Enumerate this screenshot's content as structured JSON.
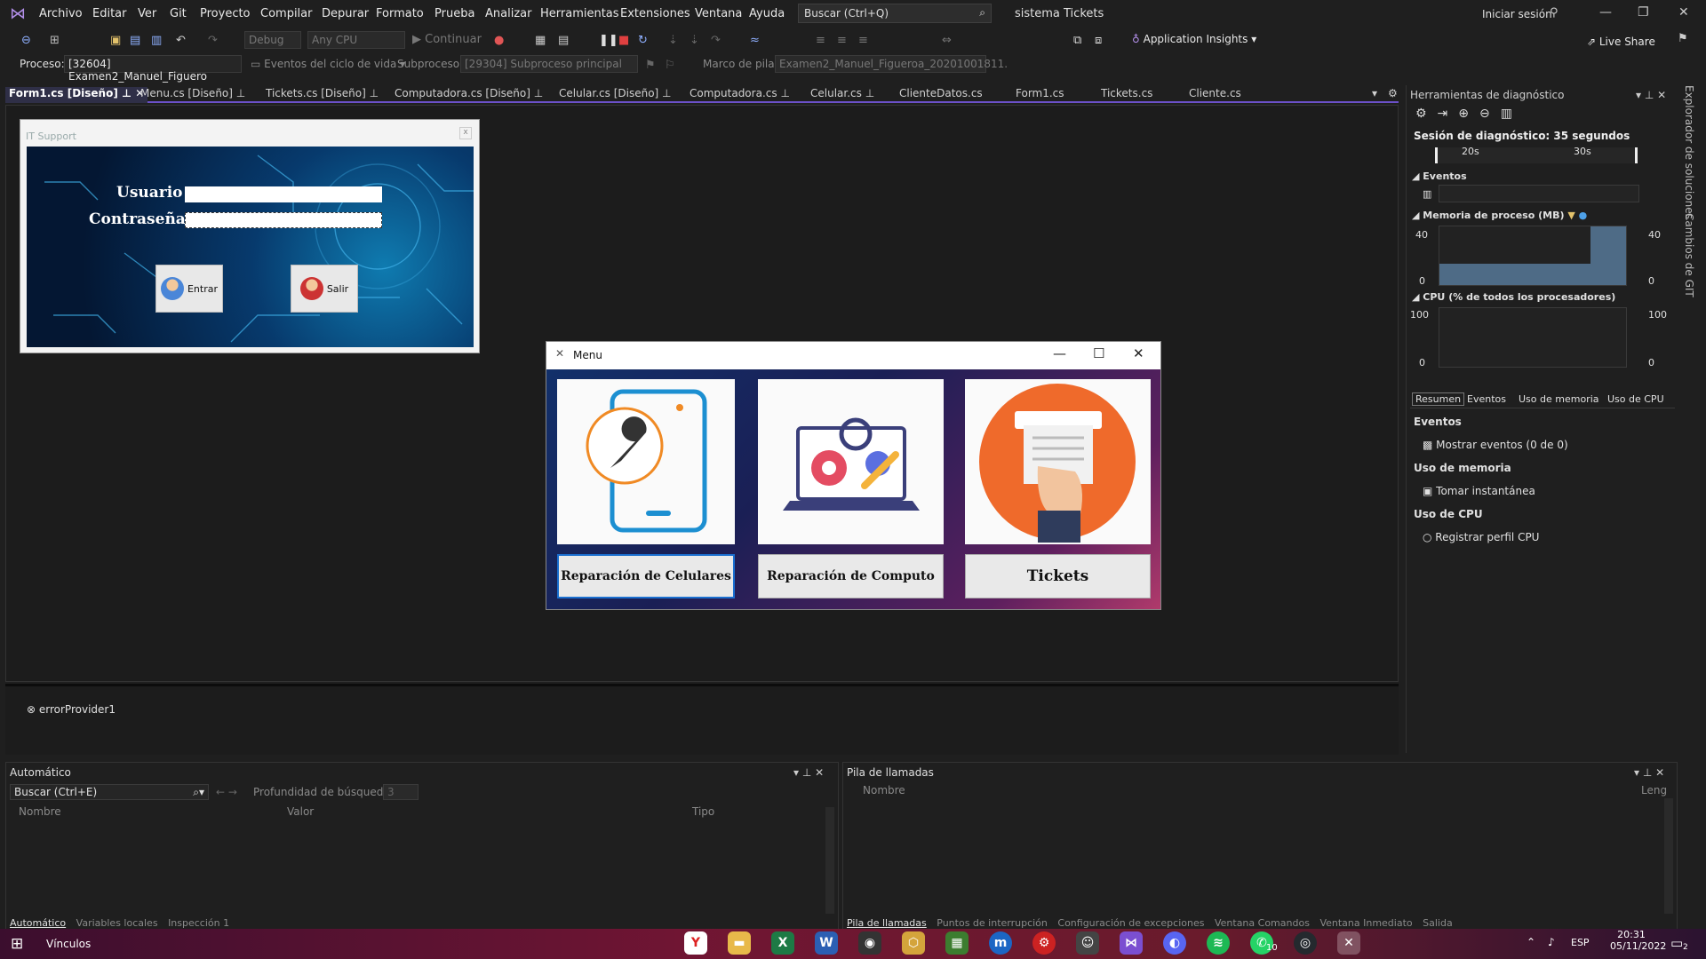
{
  "menubar": {
    "items": [
      "Archivo",
      "Editar",
      "Ver",
      "Git",
      "Proyecto",
      "Compilar",
      "Depurar",
      "Formato",
      "Prueba",
      "Analizar",
      "Herramientas",
      "Extensiones",
      "Ventana",
      "Ayuda"
    ],
    "search_text": "Buscar (Ctrl+Q)",
    "solution_title": "sistema Tickets",
    "sign_in": "Iniciar sesión"
  },
  "toolbar": {
    "config": "Debug",
    "platform": "Any CPU",
    "continue": "Continuar",
    "app_insights": "Application Insights",
    "live_share": "Live Share"
  },
  "procbar": {
    "process_label": "Proceso:",
    "process_value": "[32604] Examen2_Manuel_Figuero",
    "lifecycle": "Eventos del ciclo de vida",
    "subprocess_label": "Subproceso:",
    "subprocess_value": "[29304] Subproceso principal",
    "stackframe_label": "Marco de pila:",
    "stackframe_value": "Examen2_Manuel_Figueroa_20201001811."
  },
  "tabs": [
    "Form1.cs [Diseño]",
    "Menu.cs [Diseño]",
    "Tickets.cs [Diseño]",
    "Computadora.cs [Diseño]",
    "Celular.cs [Diseño]",
    "Computadora.cs",
    "Celular.cs",
    "ClienteDatos.cs",
    "Form1.cs",
    "Tickets.cs",
    "Cliente.cs"
  ],
  "form1": {
    "title": "IT Support",
    "user_label": "Usuario",
    "password_label": "Contraseña",
    "enter_button": "Entrar",
    "exit_button": "Salir"
  },
  "tray": {
    "component": "errorProvider1"
  },
  "menu_window": {
    "title": "Menu",
    "buttons": [
      "Reparación de Celulares",
      "Reparación de Computo",
      "Tickets"
    ]
  },
  "diagnostics": {
    "title": "Herramientas de diagnóstico",
    "session": "Sesión de diagnóstico: 35 segundos",
    "time_labels": [
      "20s",
      "30s"
    ],
    "events_header": "Eventos",
    "memory_header": "Memoria de proceso (MB)",
    "memory_max": "40",
    "memory_min": "0",
    "cpu_header": "CPU (% de todos los procesadores)",
    "cpu_max": "100",
    "cpu_min": "0",
    "memory_fill_fraction": 0.72,
    "tabs": [
      "Resumen",
      "Eventos",
      "Uso de memoria",
      "Uso de CPU"
    ],
    "sections": [
      {
        "header": "Eventos",
        "action": "Mostrar eventos (0 de 0)"
      },
      {
        "header": "Uso de memoria",
        "action": "Tomar instantánea"
      },
      {
        "header": "Uso de CPU",
        "action": "Registrar perfil CPU"
      }
    ],
    "side_tabs": [
      "Explorador de soluciones",
      "Cambios de GIT"
    ]
  },
  "auto_panel": {
    "title": "Automático",
    "search": "Buscar (Ctrl+E)",
    "depth_label": "Profundidad de búsqueda:",
    "depth_value": "3",
    "columns": [
      "Nombre",
      "Valor",
      "Tipo"
    ],
    "bottom_tabs": [
      "Automático",
      "Variables locales",
      "Inspección 1"
    ]
  },
  "call_panel": {
    "title": "Pila de llamadas",
    "columns": [
      "Nombre",
      "Leng"
    ],
    "bottom_tabs": [
      "Pila de llamadas",
      "Puntos de interrupción",
      "Configuración de excepciones",
      "Ventana Comandos",
      "Ventana Inmediato",
      "Salida"
    ]
  },
  "taskbar": {
    "links": "Vínculos",
    "lang": "ESP",
    "time": "20:31",
    "date": "05/11/2022",
    "badge_whatsapp": "10",
    "badge_notif": "2"
  }
}
